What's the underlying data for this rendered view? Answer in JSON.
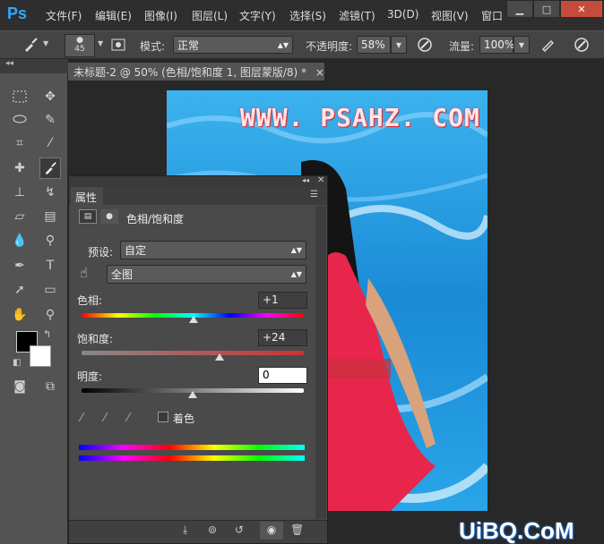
{
  "app": {
    "logo": "Ps"
  },
  "menu": [
    "文件(F)",
    "编辑(E)",
    "图像(I)",
    "图层(L)",
    "文字(Y)",
    "选择(S)",
    "滤镜(T)",
    "3D(D)",
    "视图(V)",
    "窗口"
  ],
  "window_controls": {
    "minimize": "▁",
    "restore": "□",
    "close": "✕"
  },
  "options": {
    "brush_size": "45",
    "mode_label": "模式:",
    "mode_value": "正常",
    "opacity_label": "不透明度:",
    "opacity_value": "58%",
    "flow_label": "流量:",
    "flow_value": "100%"
  },
  "document": {
    "tab_title": "未标题-2 @ 50% (色相/饱和度 1, 图层蒙版/8) *",
    "tab_close": "×"
  },
  "canvas": {
    "watermark": "WWW. PSAHZ. COM"
  },
  "panel": {
    "tab": "属性",
    "title": "色相/饱和度",
    "preset_label": "预设:",
    "preset_value": "自定",
    "channel_value": "全图",
    "hue_label": "色相:",
    "hue_value": "+1",
    "saturation_label": "饱和度:",
    "saturation_value": "+24",
    "lightness_label": "明度:",
    "lightness_value": "0",
    "colorize_label": "着色"
  },
  "adjustment_values": {
    "hue": 1,
    "saturation": 24,
    "lightness": 0
  },
  "branding": {
    "site_logo": "UiBQ.CoM"
  },
  "colors": {
    "accent": "#31a8ff",
    "canvas_water": "#1f8fd6",
    "dress": "#e8264b"
  }
}
